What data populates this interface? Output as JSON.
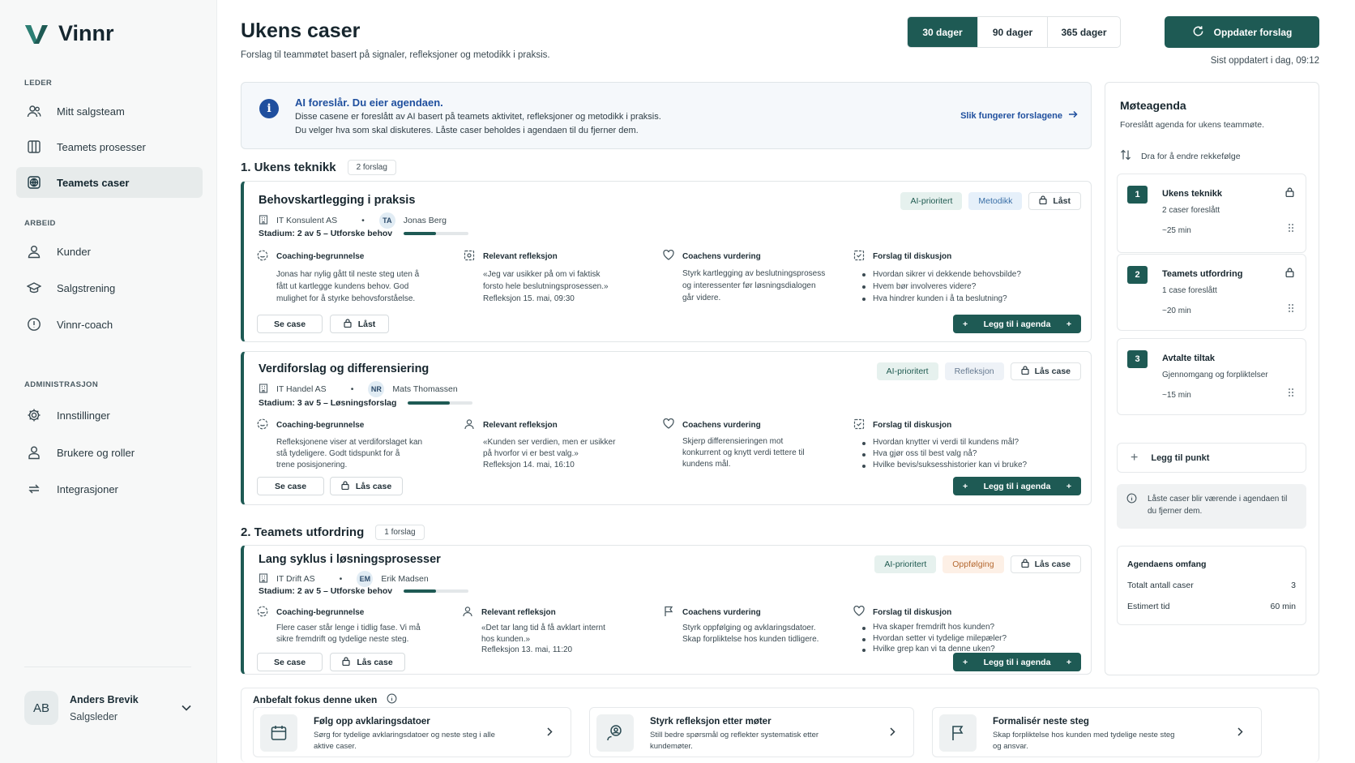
{
  "app": {
    "name": "Vinnr",
    "brand_color": "#1e5a54",
    "accent_blue": "#1f4f9e"
  },
  "sidebar": {
    "sections": [
      {
        "label": "LEDER",
        "items": [
          {
            "label": "Mitt salgsteam",
            "icon": "team-icon"
          },
          {
            "label": "Teamets prosesser",
            "icon": "columns-icon"
          },
          {
            "label": "Teamets caser",
            "icon": "globe-icon",
            "active": true
          }
        ]
      },
      {
        "label": "ARBEID",
        "items": [
          {
            "label": "Kunder",
            "icon": "user-icon"
          },
          {
            "label": "Salgstrening",
            "icon": "graduation-cap-icon"
          },
          {
            "label": "Vinnr-coach",
            "icon": "info-icon"
          }
        ]
      },
      {
        "label": "ADMINISTRASJON",
        "items": [
          {
            "label": "Innstillinger",
            "icon": "gear-icon"
          },
          {
            "label": "Brukere og roller",
            "icon": "user-role-icon"
          },
          {
            "label": "Integrasjoner",
            "icon": "sync-icon"
          }
        ]
      }
    ],
    "user": {
      "initials": "AB",
      "name": "Anders Brevik",
      "role": "Salgsleder"
    }
  },
  "header": {
    "title": "Ukens caser",
    "subtitle": "Forslag til teammøtet basert på signaler, refleksjoner og metodikk i praksis.",
    "periods": [
      "30 dager",
      "90 dager",
      "365 dager"
    ],
    "selected_period": "30 dager",
    "refresh_label": "Oppdater forslag",
    "last_updated": "Sist oppdatert i dag, 09:12"
  },
  "info": {
    "title": "AI foreslår. Du eier agendaen.",
    "line1": "Disse casene er foreslått av AI basert på teamets aktivitet, refleksjoner og metodikk i praksis.",
    "line2": "Du velger hva som skal diskuteres. Låste caser beholdes i agendaen til du fjerner dem.",
    "link": "Slik fungerer forslagene"
  },
  "sections": [
    {
      "title": "1. Ukens teknikk",
      "count": "2 forslag"
    },
    {
      "title": "2. Teamets utfordring",
      "count": "1 forslag"
    }
  ],
  "cases": [
    {
      "title": "Behovskartlegging i praksis",
      "company": "IT Konsulent AS",
      "owner_initials": "TA",
      "owner": "Jonas Berg",
      "stage": "Stadium: 2 av 5 – Utforske behov",
      "progress": 0.5,
      "tags": [
        "AI-prioritert",
        "Metodikk"
      ],
      "lock_label": "Låst",
      "columns": [
        {
          "head": "Coaching-begrunnelse",
          "lines": [
            "Jonas har nylig gått til neste steg uten å",
            "fått ut kartlegge kundens behov. God",
            "mulighet for å styrke behovsforståelse."
          ]
        },
        {
          "head": "Relevant refleksjon",
          "lines": [
            "«Jeg var usikker på om vi faktisk",
            "forsto hele beslutningsprosessen.»",
            "Refleksjon 15. mai, 09:30"
          ]
        },
        {
          "head": "Coachens vurdering",
          "lines": [
            "Styrk kartlegging av beslutningsprosess",
            "og interessenter før løsningsdialogen",
            "går videre."
          ]
        },
        {
          "head": "Forslag til diskusjon",
          "bullets": [
            "Hvordan sikrer vi dekkende behovsbilde?",
            "Hvem bør involveres videre?",
            "Hva hindrer kunden i å ta beslutning?"
          ]
        }
      ],
      "see_label": "Se case",
      "lock_btn": "Låst",
      "add_label": "Legg til i agenda"
    },
    {
      "title": "Verdiforslag og differensiering",
      "company": "IT Handel AS",
      "owner_initials": "NR",
      "owner": "Mats Thomassen",
      "stage": "Stadium: 3 av 5 – Løsningsforslag",
      "progress": 0.65,
      "tags": [
        "AI-prioritert",
        "Refleksjon"
      ],
      "lock_label": "Lås case",
      "columns": [
        {
          "head": "Coaching-begrunnelse",
          "lines": [
            "Refleksjonene viser at verdiforslaget kan",
            "stå tydeligere. Godt tidspunkt for å",
            "trene posisjonering."
          ]
        },
        {
          "head": "Relevant refleksjon",
          "lines": [
            "«Kunden ser verdien, men er usikker",
            "på hvorfor vi er best valg.»",
            "Refleksjon 14. mai, 16:10"
          ]
        },
        {
          "head": "Coachens vurdering",
          "lines": [
            "Skjerp differensieringen mot",
            "konkurrent og knytt verdi tettere til",
            "kundens mål."
          ]
        },
        {
          "head": "Forslag til diskusjon",
          "bullets": [
            "Hvordan knytter vi verdi til kundens mål?",
            "Hva gjør oss til best valg nå?",
            "Hvilke bevis/suksesshistorier kan vi bruke?"
          ]
        }
      ],
      "see_label": "Se case",
      "lock_btn": "Lås case",
      "add_label": "Legg til i agenda"
    },
    {
      "title": "Lang syklus i løsningsprosesser",
      "company": "IT Drift AS",
      "owner_initials": "EM",
      "owner": "Erik Madsen",
      "stage": "Stadium: 2 av 5 – Utforske behov",
      "progress": 0.5,
      "tags": [
        "AI-prioritert",
        "Oppfølging"
      ],
      "lock_label": "Lås case",
      "columns": [
        {
          "head": "Coaching-begrunnelse",
          "lines": [
            "Flere caser står lenge i tidlig fase. Vi må",
            "sikre fremdrift og tydelige neste steg."
          ]
        },
        {
          "head": "Relevant refleksjon",
          "lines": [
            "«Det tar lang tid å få avklart internt",
            "hos kunden.»",
            "Refleksjon 13. mai, 11:20"
          ]
        },
        {
          "head": "Coachens vurdering",
          "lines": [
            "Styrk oppfølging og avklaringsdatoer.",
            "Skap forpliktelse hos kunden tidligere."
          ]
        },
        {
          "head": "Forslag til diskusjon",
          "bullets": [
            "Hva skaper fremdrift hos kunden?",
            "Hvordan setter vi tydelige milepæler?",
            "Hvilke grep kan vi ta denne uken?"
          ]
        }
      ],
      "see_label": "Se case",
      "lock_btn": "Lås case",
      "add_label": "Legg til i agenda"
    }
  ],
  "agenda": {
    "title": "Møteagenda",
    "subtitle": "Foreslått agenda for ukens teammøte.",
    "drag_hint": "Dra for å endre rekkefølge",
    "items": [
      {
        "num": "1",
        "name": "Ukens teknikk",
        "desc": "2 caser foreslått",
        "time": "~25 min",
        "locked": true
      },
      {
        "num": "2",
        "name": "Teamets utfordring",
        "desc": "1 case foreslått",
        "time": "~20 min",
        "locked": true
      },
      {
        "num": "3",
        "name": "Avtalte tiltak",
        "desc": "Gjennomgang og forpliktelser",
        "time": "~15 min",
        "locked": false
      }
    ],
    "add_label": "Legg til punkt",
    "note": "Låste caser blir værende i agendaen til du fjerner dem.",
    "scope": {
      "title": "Agendaens omfang",
      "total_label": "Totalt antall caser",
      "total": "3",
      "time_label": "Estimert tid",
      "time": "60 min"
    }
  },
  "focus": {
    "title": "Anbefalt fokus denne uken",
    "cards": [
      {
        "title": "Følg opp avklaringsdatoer",
        "desc": "Sørg for tydelige avklaringsdatoer og neste steg i alle aktive caser.",
        "icon": "calendar-icon"
      },
      {
        "title": "Styrk refleksjon etter møter",
        "desc": "Still bedre spørsmål og reflekter systematisk etter kundemøter.",
        "icon": "reflection-icon"
      },
      {
        "title": "Formalisér neste steg",
        "desc": "Skap forpliktelse hos kunden med tydelige neste steg og ansvar.",
        "icon": "flag-icon"
      }
    ]
  }
}
